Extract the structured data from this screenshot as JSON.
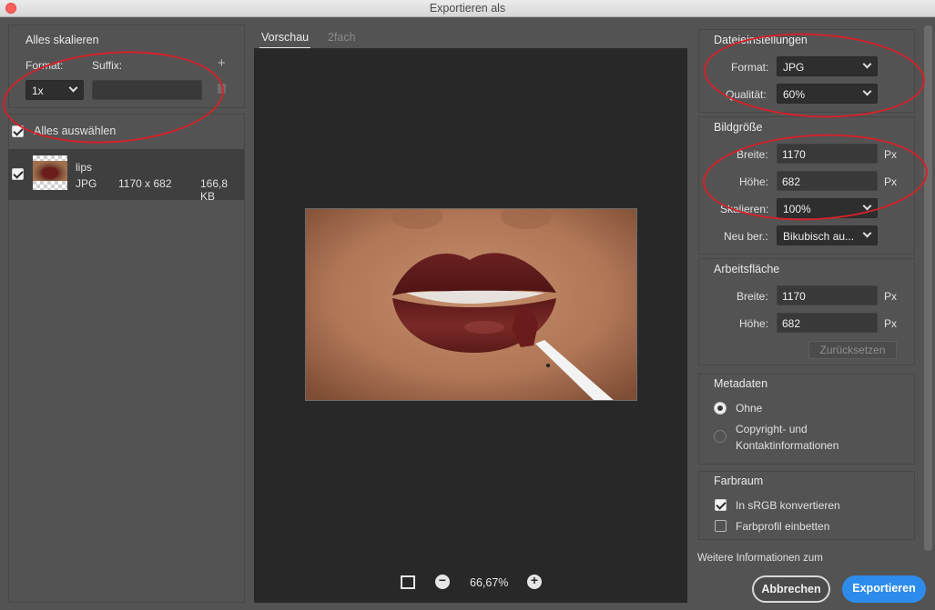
{
  "window": {
    "title": "Exportieren als"
  },
  "left": {
    "scale_all_heading": "Alles skalieren",
    "format_label": "Format:",
    "suffix_label": "Suffix:",
    "scale_value": "1x",
    "suffix_value": "",
    "select_all_label": "Alles auswählen",
    "select_all_checked": true,
    "assets": [
      {
        "name": "lips",
        "format": "JPG",
        "dimensions": "1170 x 682",
        "size": "166,8 KB",
        "checked": true
      }
    ]
  },
  "preview": {
    "tabs": [
      {
        "label": "Vorschau",
        "active": true
      },
      {
        "label": "2fach",
        "active": false
      }
    ],
    "zoom": "66,67%"
  },
  "file_settings": {
    "heading": "Dateieinstellungen",
    "format_label": "Format:",
    "format_value": "JPG",
    "quality_label": "Qualität:",
    "quality_value": "60%"
  },
  "image_size": {
    "heading": "Bildgröße",
    "width_label": "Breite:",
    "width_value": "1170",
    "height_label": "Höhe:",
    "height_value": "682",
    "unit": "Px",
    "scale_label": "Skalieren:",
    "scale_value": "100%",
    "resample_label": "Neu ber.:",
    "resample_value": "Bikubisch au..."
  },
  "canvas": {
    "heading": "Arbeitsfläche",
    "width_label": "Breite:",
    "width_value": "1170",
    "height_label": "Höhe:",
    "height_value": "682",
    "unit": "Px",
    "reset_label": "Zurücksetzen"
  },
  "metadata": {
    "heading": "Metadaten",
    "option_none": "Ohne",
    "option_copyright_line1": "Copyright- und",
    "option_copyright_line2": "Kontaktinformationen",
    "selected": "Ohne"
  },
  "color_space": {
    "heading": "Farbraum",
    "convert_srgb": "In sRGB konvertieren",
    "convert_srgb_checked": true,
    "embed_profile": "Farbprofil einbetten",
    "embed_profile_checked": false
  },
  "footer": {
    "more_info": "Weitere Informationen zum",
    "cancel": "Abbrechen",
    "export": "Exportieren"
  },
  "colors": {
    "accent": "#2d8ceb",
    "annotation_red": "#d3222a"
  }
}
